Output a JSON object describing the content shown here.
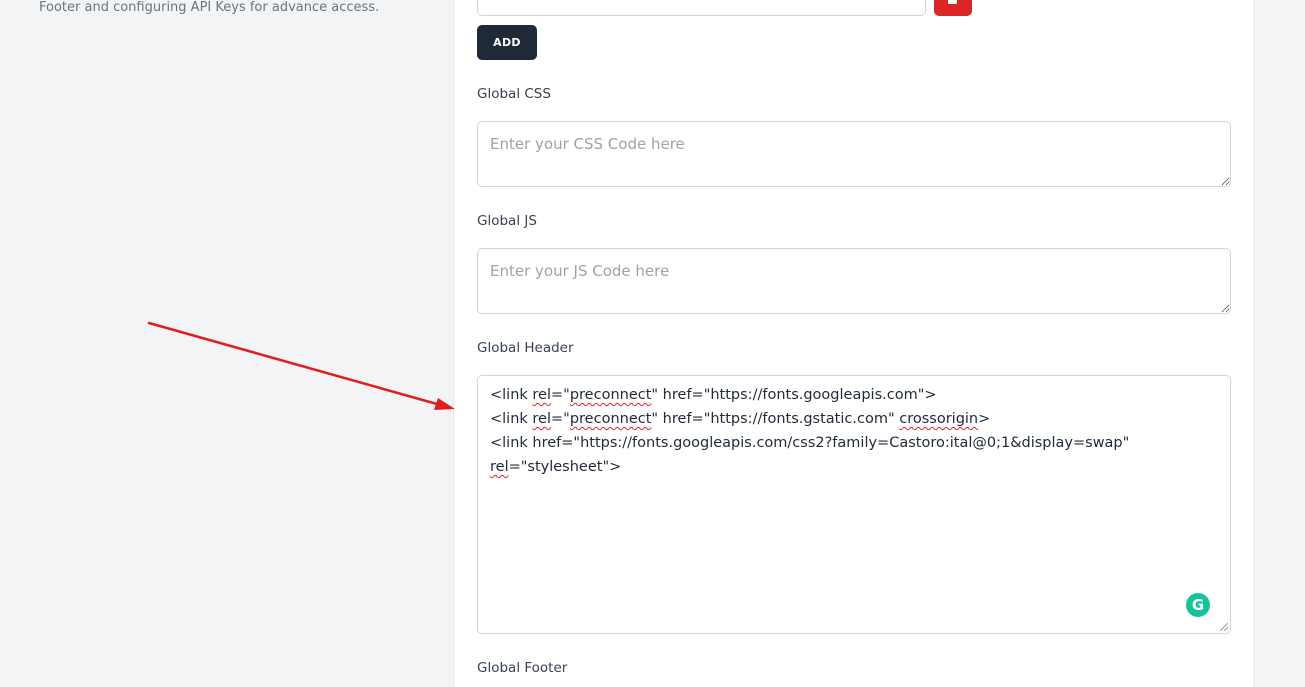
{
  "left_panel": {
    "description": "Footer and configuring API Keys for advance access."
  },
  "form": {
    "add_button": "ADD",
    "global_css": {
      "label": "Global CSS",
      "placeholder": "Enter your CSS Code here",
      "value": ""
    },
    "global_js": {
      "label": "Global JS",
      "placeholder": "Enter your JS Code here",
      "value": ""
    },
    "global_header": {
      "label": "Global Header",
      "lines": [
        {
          "a": "<link ",
          "b": "rel",
          "c": "=\"",
          "d": "preconnect",
          "e": "\" href=\"https://fonts.googleapis.com\">"
        },
        {
          "a": "<link ",
          "b": "rel",
          "c": "=\"",
          "d": "preconnect",
          "e": "\" href=\"https://fonts.gstatic.com\" ",
          "f": "crossorigin",
          "g": ">"
        },
        {
          "a": "<link href=\"https://fonts.googleapis.com/css2?family=Castoro:ital@0;1&display=swap\""
        },
        {
          "b": "rel",
          "c": "=\"stylesheet\">"
        }
      ]
    },
    "global_footer": {
      "label": "Global Footer"
    }
  },
  "icons": {
    "delete": "trash-icon",
    "grammarly": "grammarly-icon",
    "annotation": "red-arrow-annotation"
  },
  "colors": {
    "background": "#f3f4f6",
    "card": "#ffffff",
    "add_button": "#1f2937",
    "delete_button": "#dc2626",
    "annotation_arrow": "#e11d1d",
    "grammarly": "#15c39a"
  }
}
